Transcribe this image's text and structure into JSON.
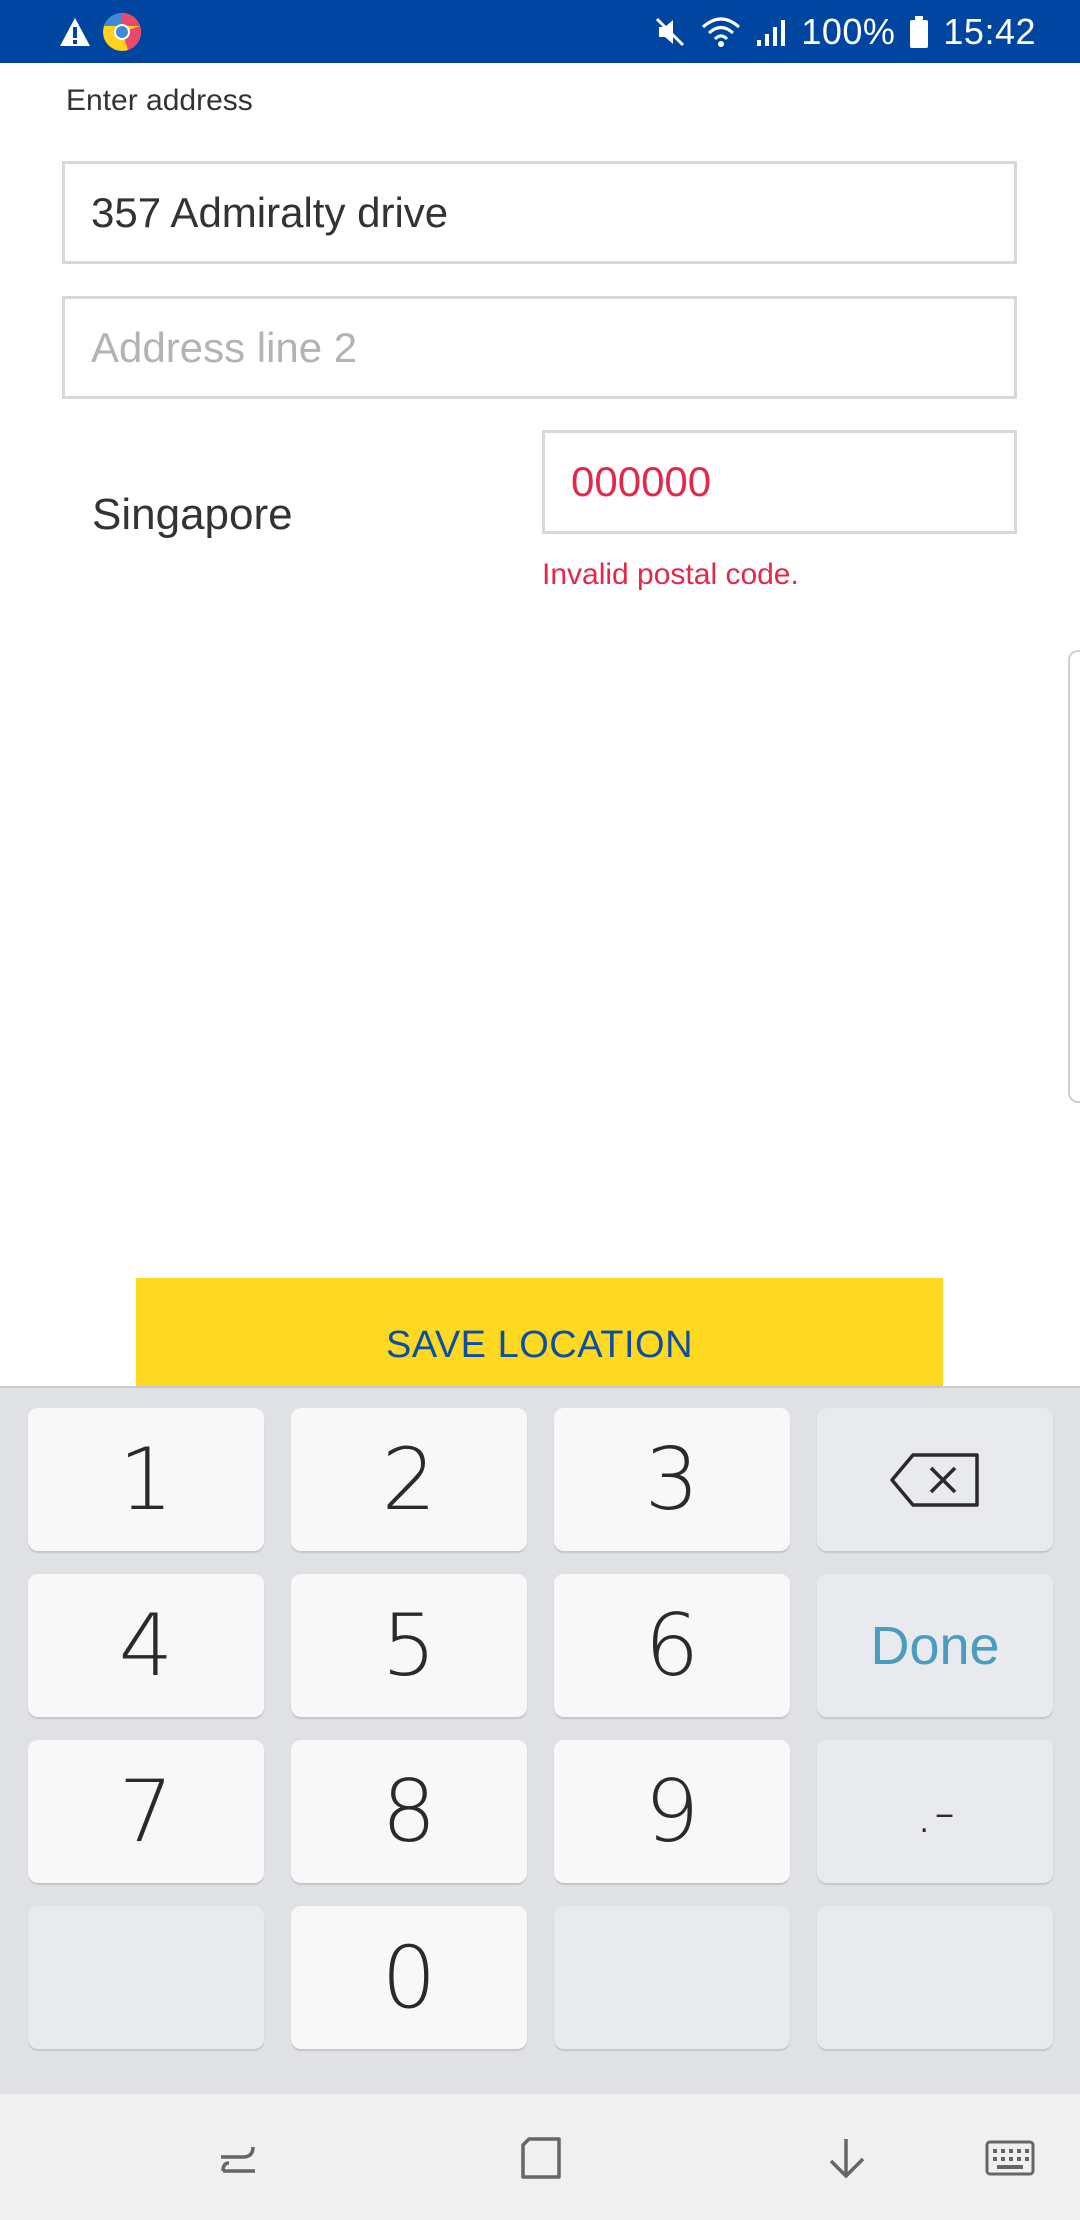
{
  "status_bar": {
    "icons": [
      "alert-icon",
      "chrome-icon",
      "mute-icon",
      "wifi-icon",
      "signal-icon",
      "battery-icon"
    ],
    "battery": "100%",
    "time": "15:42",
    "background_color": "#0046a0"
  },
  "form": {
    "heading": "Enter address",
    "address_line_1": {
      "value": "357 Admiralty drive",
      "placeholder": ""
    },
    "address_line_2": {
      "value": "",
      "placeholder": "Address line 2"
    },
    "country": "Singapore",
    "postal_code": {
      "value": "000000",
      "error": "Invalid postal code."
    },
    "error_color": "#e5274a"
  },
  "save_button": {
    "label": "SAVE LOCATION",
    "color": "#ffd921",
    "text_color": "#0b4ea2"
  },
  "keyboard": {
    "keys": {
      "k1": "1",
      "k2": "2",
      "k3": "3",
      "k4": "4",
      "k5": "5",
      "k6": "6",
      "k7": "7",
      "k8": "8",
      "k9": "9",
      "k0": "0",
      "done": "Done",
      "symbols": ".-"
    },
    "icons": [
      "backspace-icon"
    ]
  },
  "nav_bar": {
    "icons": [
      "recent-apps-icon",
      "home-icon",
      "hide-keyboard-icon",
      "keyboard-switch-icon"
    ]
  }
}
